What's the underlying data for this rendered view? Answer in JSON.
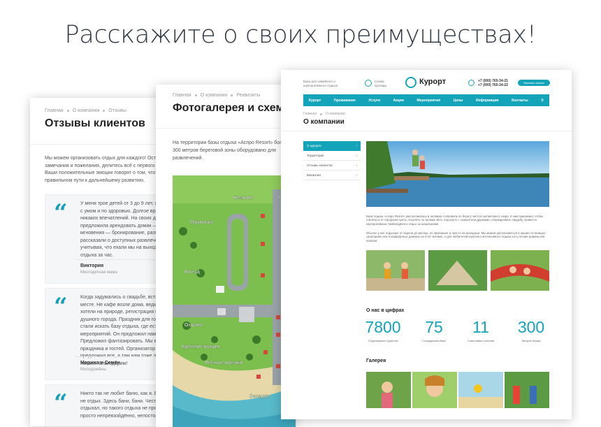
{
  "headline": "Расскажите о своих преимуществах!",
  "card_reviews": {
    "breadcrumb": [
      "Главная",
      "О компании",
      "Отзывы"
    ],
    "title": "Отзывы клиентов",
    "intro": "Мы можем организовать отдых для каждого! Оставляйте замечания и пожелания, делитесь всё с первого мгновения Ваши положительные эмоции говорят о том, что мы на правильном пути к дальнейшему развитию.",
    "reviews": [
      {
        "text": "У меня трое детей от 3 до 9 лет, и отдыхать нужно с умом и по здоровью. Долгое время не дарили никаких впечатлений. На своих двоих, предложила арендовать домик — всё с первого мгновения — бронирование, размещения, рассказали о доступных развлечениях, удобно, учитывая, что ехали мы на выходные в места отдыха за час.",
        "name": "Виктория",
        "role": "Многодетная мама"
      },
      {
        "text": "Когда задумались о свадьбе, встал вопрос о месте. Не кафе возле дома, ведь родственники хотели на природе, регистрация в июле, из душного города. Праздник для гостей. В итоге стали искать базу отдыха, где есть организатор мероприятий. Он предложил нам варианты. Предложил фантазировать. Мы в восторге от праздника и гостей. Организатор подобрал, предложил все, а там нам тоже это делать нельзя. Благодарим!",
        "name": "Марина и Семён",
        "role": "Молодожёны"
      },
      {
        "text": "Никто так не любит баню, как я. Без бани отдых — не отдых. Здесь бани, бани. Честно, много отдыхал, но такого отдыха не пробовал. Это просто непревзойдённо, непостоянно, я вернусь!",
        "name": "",
        "role": ""
      }
    ]
  },
  "card_gallery": {
    "breadcrumb": [
      "Главная",
      "О компании",
      "Реквизиты"
    ],
    "title": "Фотогалерея и схема",
    "intro": "На территории базы отдыха «Аспро Resort» больше! 300 метров береговой зоны оборудовано для развлечений.",
    "map_labels": [
      "Кемпинг",
      "Парковка",
      "Въезд",
      "Охрана",
      "Администрация",
      "Лесные домики",
      "Беседки",
      "Г"
    ]
  },
  "card_about": {
    "header": {
      "tagline": "База для семейного и корпоративного отдыха",
      "location": "Схема проезда",
      "logo": "Курорт",
      "phone1": "+7 (000) 765-34-21",
      "phone2": "+7 (000) 765-34-22",
      "callback": "Заказать звонок"
    },
    "nav": [
      "Курорт",
      "Проживание",
      "Услуги",
      "Акции",
      "Мероприятия",
      "Цены",
      "Информация",
      "Контакты"
    ],
    "breadcrumb": [
      "Главная",
      "О компании"
    ],
    "title": "О компании",
    "menu": [
      "О курорте",
      "Территория",
      "Отзывы клиентов",
      "Вакансии"
    ],
    "para1": "База отдыха «Аспро Resort» расположилась в экопарке Аспроволь по берегу чистого реликтового озера. К нам приезжают, чтобы отвлечься от городской суеты, погулять по тропам леса, отдохнуть с семьей или друзьями, отпраздновать свадьбу, провести корпоративные тимбилдинги и отдых за шашлыками.",
    "para2": "Обычно у нас отдыхают от недели до месяца, но приезжают и просто на выходные. Мы можем расположиться в наших гостиницах-санаториях или в комфортных домиках на 3-10 человек. А для любителей короткого интенсивного отдыха есть летние домики или палатки.",
    "stats_title": "О нас в цифрах",
    "stats": [
      {
        "value": "7800",
        "label": "Отдохнувших туристов"
      },
      {
        "value": "75",
        "label": "Сотрудников базы"
      },
      {
        "value": "11",
        "label": "Счастливых сезонов"
      },
      {
        "value": "300",
        "label": "Метров пляжа"
      }
    ],
    "gallery_title": "Галерея"
  },
  "colors": {
    "accent": "#13a4ba",
    "quote": "#19a0b8"
  }
}
